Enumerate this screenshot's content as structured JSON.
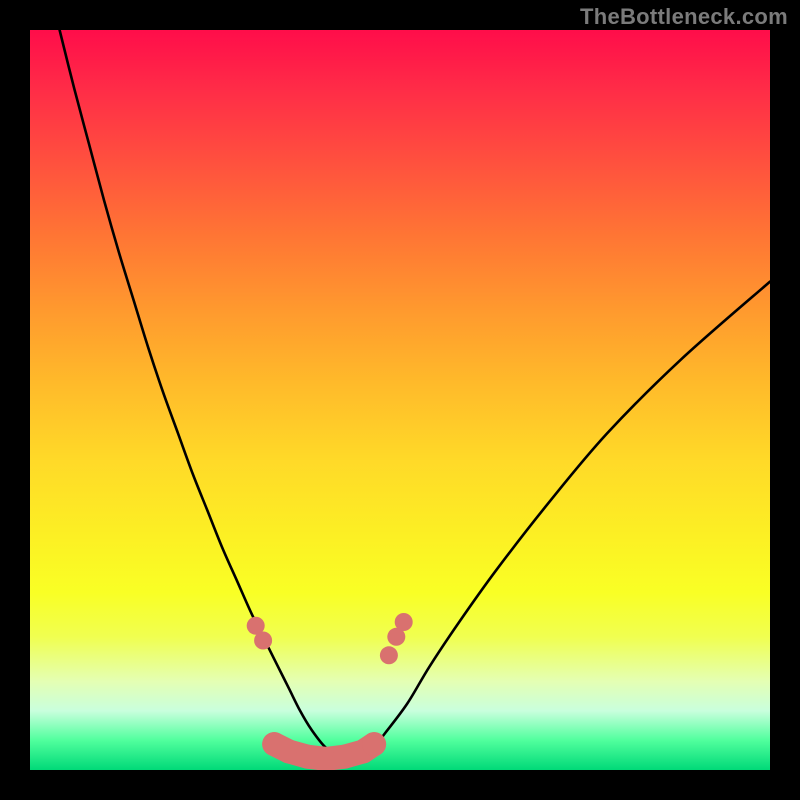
{
  "watermark": "TheBottleneck.com",
  "chart_data": {
    "type": "line",
    "title": "",
    "xlabel": "",
    "ylabel": "",
    "xlim": [
      0,
      100
    ],
    "ylim": [
      0,
      100
    ],
    "grid": false,
    "series": [
      {
        "name": "bottleneck-curve",
        "x": [
          4,
          6,
          8,
          10,
          12,
          14,
          16,
          18,
          20,
          22,
          24,
          26,
          28,
          30,
          32,
          33.5,
          35,
          36.5,
          38,
          40,
          42,
          44,
          46,
          48,
          51,
          54,
          58,
          63,
          70,
          78,
          88,
          100
        ],
        "values": [
          100,
          92,
          84.5,
          77,
          70,
          63.5,
          57,
          51,
          45.5,
          40,
          35,
          30,
          25.5,
          21,
          17,
          14,
          11,
          8,
          5.5,
          3,
          2,
          1.5,
          2.5,
          5,
          9,
          14,
          20,
          27,
          36,
          45.5,
          55.5,
          66
        ],
        "color": "#000000"
      }
    ],
    "markers": {
      "name": "recommended-zone",
      "points": [
        {
          "x": 30.5,
          "y": 19.5
        },
        {
          "x": 31.5,
          "y": 17.5
        },
        {
          "x": 33.0,
          "y": 3.5
        },
        {
          "x": 35.0,
          "y": 2.5
        },
        {
          "x": 37.5,
          "y": 1.8
        },
        {
          "x": 40.0,
          "y": 1.5
        },
        {
          "x": 42.5,
          "y": 1.8
        },
        {
          "x": 45.0,
          "y": 2.5
        },
        {
          "x": 46.5,
          "y": 3.5
        },
        {
          "x": 48.5,
          "y": 15.5
        },
        {
          "x": 49.5,
          "y": 18.0
        },
        {
          "x": 50.5,
          "y": 20.0
        }
      ],
      "color": "#d9716f"
    },
    "gradient_stops": [
      {
        "pos": 0,
        "color": "#ff0d4a"
      },
      {
        "pos": 50,
        "color": "#ffd024"
      },
      {
        "pos": 80,
        "color": "#f5ff40"
      },
      {
        "pos": 100,
        "color": "#00d978"
      }
    ]
  }
}
